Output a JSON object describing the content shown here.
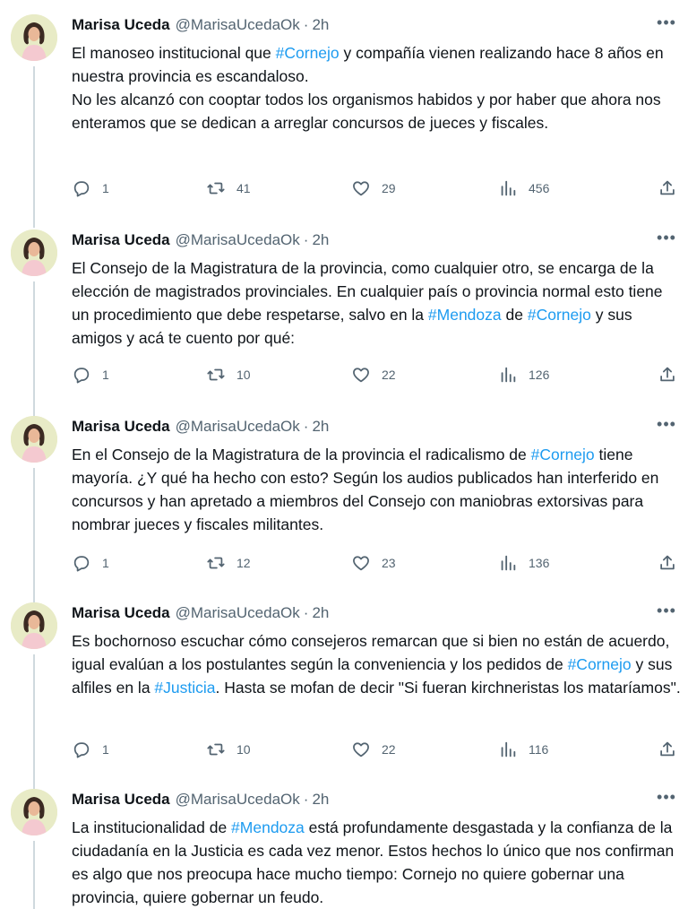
{
  "author": {
    "name": "Marisa Uceda",
    "handle": "@MarisaUcedaOk",
    "separator": "·",
    "time": "2h"
  },
  "more_label": "•••",
  "colors": {
    "link": "#1d9bf0",
    "secondary": "#536471",
    "thread_line": "#cfd9de"
  },
  "tweets": [
    {
      "paragraphs": [
        [
          {
            "t": "El manoseo institucional que "
          },
          {
            "t": "#Cornejo",
            "tag": true
          },
          {
            "t": " y compañía vienen realizando hace 8 años en nuestra provincia es escandaloso."
          }
        ],
        [
          {
            "t": "No les alcanzó con cooptar todos los organismos habidos y por haber que ahora nos enteramos que se dedican a arreglar concursos de jueces y fiscales."
          }
        ]
      ],
      "replies": "1",
      "retweets": "41",
      "likes": "29",
      "views": "456"
    },
    {
      "paragraphs": [
        [
          {
            "t": "El Consejo de la Magistratura de la provincia, como cualquier otro, se encarga de la elección de magistrados provinciales. En cualquier país o provincia normal esto tiene un procedimiento que debe respetarse, salvo en la "
          },
          {
            "t": "#Mendoza",
            "tag": true
          },
          {
            "t": " de "
          },
          {
            "t": "#Cornejo",
            "tag": true
          },
          {
            "t": " y sus amigos y acá te cuento por qué:"
          }
        ]
      ],
      "replies": "1",
      "retweets": "10",
      "likes": "22",
      "views": "126"
    },
    {
      "paragraphs": [
        [
          {
            "t": "En el Consejo de la Magistratura de la provincia el radicalismo de "
          },
          {
            "t": "#Cornejo",
            "tag": true
          },
          {
            "t": " tiene mayoría. ¿Y qué ha hecho con esto? Según los audios publicados han interferido en concursos y han apretado a miembros del Consejo con maniobras extorsivas para nombrar jueces y fiscales militantes."
          }
        ]
      ],
      "replies": "1",
      "retweets": "12",
      "likes": "23",
      "views": "136"
    },
    {
      "paragraphs": [
        [
          {
            "t": "Es bochornoso escuchar cómo consejeros remarcan que si bien no están de acuerdo, igual evalúan a los postulantes según la conveniencia y los pedidos de "
          },
          {
            "t": "#Cornejo",
            "tag": true
          },
          {
            "t": " y sus alfiles en la "
          },
          {
            "t": "#Justicia",
            "tag": true
          },
          {
            "t": ". Hasta se mofan de decir \"Si fueran kirchneristas los mataríamos\"."
          }
        ]
      ],
      "replies": "1",
      "retweets": "10",
      "likes": "22",
      "views": "116"
    },
    {
      "paragraphs": [
        [
          {
            "t": "La institucionalidad de "
          },
          {
            "t": "#Mendoza",
            "tag": true
          },
          {
            "t": " está profundamente desgastada y la confianza de la ciudadanía en la Justicia es cada vez menor. Estos hechos lo único que nos confirman es algo que nos preocupa hace mucho tiempo: Cornejo no quiere gobernar una provincia, quiere gobernar un feudo."
          }
        ]
      ]
    }
  ]
}
